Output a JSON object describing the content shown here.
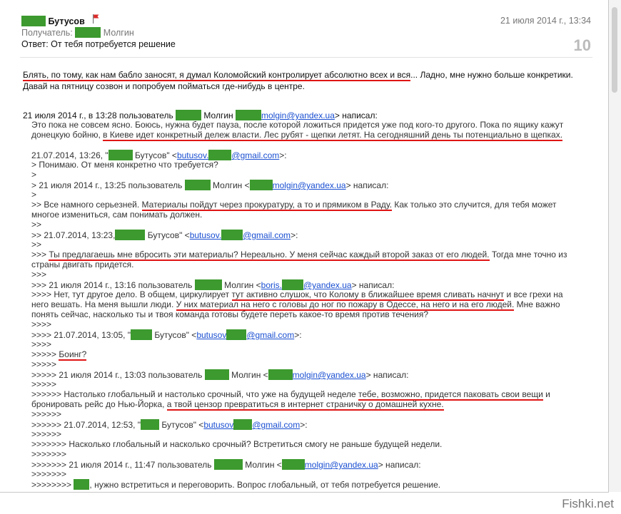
{
  "header": {
    "sender_name": "Бутусов",
    "recipient_label": "Получатель:",
    "recipient_name": "Молгин",
    "subject": "Ответ: От тебя потребуется решение",
    "date": "21 июля 2014 г., 13:34",
    "count": "10"
  },
  "body": {
    "p1a": "Блять, по тому, как нам бабло заносят, я думал Коломойский контролирует абсолютно всех и вся",
    "p1b": "... Ладно, мне нужно больше конкретики.",
    "p2": "Давай на пятницу созвон и попробуем поймать­ся где-нибудь в центре.",
    "a1a": "21 июля 2014 г., в 13:28 пользователь",
    "a1b": "Молгин",
    "a1c": "molgin@yandex.ua",
    "a1d": "> написал:",
    "q1a": "Это пока не совсем ясно. Боюсь, нужна будет пауза, после которой ложиться придется уже под кого-то другого. Пока по ящику кажут",
    "q1b": "донецкую бойню,",
    "q1c": "в Киеве идет конкретный дележ власти. Лес рубят - щепки летят. На сегодняшний день ты потенциально в щепках.",
    "a2a": "21.07.2014, 13:26, \"",
    "a2b": "Бутусов\" <",
    "a2c": "butusov.",
    "a2d": "@gmail.com",
    "a2e": ">:",
    "q2": "> Понимаю. От меня конкретно что требуется?",
    "gt1": ">",
    "a3a": "> 21 июля 2014 г., 13:25 пользователь",
    "a3b": "Молгин <",
    "a3c": "molgin@yandex.ua",
    "a3d": "> написал:",
    "gt2": ">",
    "q3a": ">> Все намного серьезней.",
    "q3b": "Материалы пойдут через прокуратуру, а то и прямиком в Раду.",
    "q3c": "Как только это случится, для тебя может",
    "q3d": "многое измениться, сам понимать должен.",
    "gt3": ">>",
    "a4a": ">> 21.07.2014, 13:23,",
    "a4b": "Бутусов\" <",
    "a4c": "butusov.",
    "a4d": "@gmail.com",
    "a4e": ">:",
    "gt4": ">>",
    "q4a": ">>>",
    "q4b": "Ты предлагаешь мне вбросить эти материалы? Нереально. У меня сейчас каждый второй заказ от его людей.",
    "q4c": "Тогда мне точно из",
    "q4d": "страны двигать придется.",
    "gt5": ">>>",
    "a5a": ">>> 21 июля 2014 г., 13:16 пользователь",
    "a5b": "Молгин <",
    "a5c": "boris.",
    "a5d": "@yandex.ua",
    "a5e": "> написал:",
    "q5a": ">>>> Нет, тут другое дело. В общем, циркулирует",
    "q5b": "тут активно слушок, что Колому в ближайшее время сливать начнут",
    "q5c": "и все грехи на",
    "q5d": "него вешать. На меня вышли люди.",
    "q5e": "У них материал на него с головы до ног по пожару в Одессе, на него и на его людей.",
    "q5f": "Мне важно",
    "q5g": "понять сейчас, насколько ты и твоя команда готовы будете переть какое-то время против течения?",
    "gt6": ">>>>",
    "a6a": ">>>> 21.07.2014, 13:05, \"",
    "a6b": "Бутусов\" <",
    "a6c": "butusov",
    "a6d": "@gmail.com",
    "a6e": ">:",
    "gt7": ">>>>",
    "q6a": ">>>>>",
    "q6b": "Боинг?",
    "gt8": ">>>>>",
    "a7a": ">>>>> 21 июля 2014 г., 13:03 пользователь",
    "a7b": "Молгин <",
    "a7c": "molgin@yandex.ua",
    "a7d": "> написал:",
    "gt9": ">>>>>",
    "q7a": ">>>>>> Настолько глобальный и настолько срочный, что уже на будущей неделе",
    "q7b": "тебе, возможно, придется паковать свои вещи",
    "q7c": "и",
    "q7d": "бронировать рейс до Нью-Йорка,",
    "q7e": "а твой цензор превратиться в интернет страничку о домашней кухне.",
    "gt10": ">>>>>>",
    "a8a": ">>>>>> 21.07.2014, 12:53, \"",
    "a8b": "Бутусов\" <",
    "a8c": "butusov",
    "a8d": "@gmail.com",
    "a8e": ">:",
    "gt11": ">>>>>>",
    "q8": ">>>>>>> Насколько глобальный и насколько срочный? Встретиться смогу не раньше будущей недели.",
    "gt12": ">>>>>>>",
    "a9a": ">>>>>>> 21 июля 2014 г., 11:47 пользователь",
    "a9b": "Молгин <",
    "a9c": "molgin@yandex.ua",
    "a9d": "> написал:",
    "gt13": ">>>>>>>",
    "q9a": ">>>>>>>>",
    "q9b": ", нужно встретиться и переговорить. Вопрос глобальный, от тебя потребуется решение."
  },
  "watermark": "Fishki.net",
  "colors": {
    "link": "#1a4fd1",
    "underline": "#e01414",
    "redaction": "#3c9a2e",
    "count": "#bbbbbb"
  },
  "icons": [
    "flag-icon"
  ]
}
